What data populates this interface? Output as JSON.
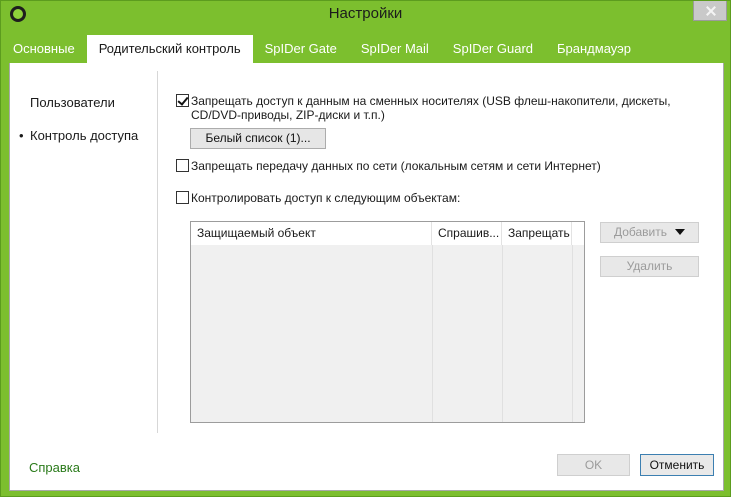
{
  "window": {
    "title": "Настройки"
  },
  "tabs": [
    {
      "label": "Основные",
      "active": false
    },
    {
      "label": "Родительский контроль",
      "active": true
    },
    {
      "label": "SpIDer Gate",
      "active": false
    },
    {
      "label": "SpIDer Mail",
      "active": false
    },
    {
      "label": "SpIDer Guard",
      "active": false
    },
    {
      "label": "Брандмауэр",
      "active": false
    }
  ],
  "sidebar": {
    "items": [
      {
        "label": "Пользователи",
        "selected": false
      },
      {
        "label": "Контроль доступа",
        "selected": true,
        "bullet": "•"
      }
    ]
  },
  "options": {
    "block_removable": {
      "checked": true,
      "line1": "Запрещать доступ к данным на сменных носителях (USB флеш-накопители, дискеты,",
      "line2": "CD/DVD-приводы, ZIP-диски и т.п.)"
    },
    "whitelist_button": "Белый список (1)...",
    "block_network": {
      "checked": false,
      "label": "Запрещать передачу данных по сети (локальным сетям и сети Интернет)"
    },
    "control_objects": {
      "checked": false,
      "label": "Контролировать доступ к следующим объектам:"
    }
  },
  "table": {
    "columns": [
      "Защищаемый объект",
      "Спрашив...",
      "Запрещать"
    ],
    "rows": []
  },
  "side_buttons": {
    "add": "Добавить",
    "remove": "Удалить"
  },
  "footer": {
    "help": "Справка",
    "ok": "OK",
    "cancel": "Отменить"
  },
  "colors": {
    "brand_green": "#7cbf2e",
    "link_green": "#2a7a1a"
  }
}
